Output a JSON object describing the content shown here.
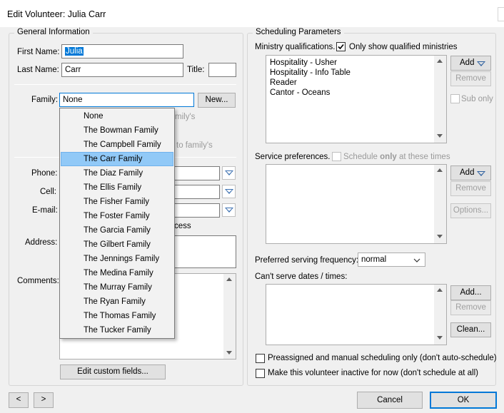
{
  "window": {
    "title": "Edit Volunteer: Julia Carr"
  },
  "general": {
    "legend": "General Information",
    "first_name_label": "First Name:",
    "first_name_value": "Julia",
    "last_name_label": "Last Name:",
    "last_name_value": "Carr",
    "title_label": "Title:",
    "title_value": "",
    "family_label": "Family:",
    "family_value": "None",
    "new_button": "New...",
    "hint_line1_suffix": "mily's",
    "hint_line2_suffix": "to family's",
    "phone_label": "Phone:",
    "cell_label": "Cell:",
    "email_label": "E-mail:",
    "access_suffix": "cess",
    "address_label": "Address:",
    "comments_label": "Comments:",
    "edit_custom_fields_button": "Edit custom fields..."
  },
  "family_dropdown": {
    "items": [
      "None",
      "The Bowman Family",
      "The Campbell Family",
      "The Carr Family",
      "The Diaz Family",
      "The Ellis Family",
      "The Fisher Family",
      "The Foster Family",
      "The Garcia Family",
      "The Gilbert Family",
      "The Jennings Family",
      "The Medina Family",
      "The Murray Family",
      "The Ryan Family",
      "The Thomas Family",
      "The Tucker Family"
    ],
    "selected": "The Carr Family"
  },
  "scheduling": {
    "legend": "Scheduling Parameters",
    "ministry_label": "Ministry qualifications.",
    "only_qualified_label": "Only show qualified ministries",
    "only_qualified_checked": true,
    "ministries": [
      "Hospitality - Usher",
      "Hospitality - Info Table",
      "Reader",
      "Cantor - Oceans"
    ],
    "add_button": "Add",
    "remove_button": "Remove",
    "sub_only_label": "Sub only",
    "service_pref_label": "Service preferences.",
    "schedule_only_prefix": "Schedule ",
    "schedule_only_bold": "only",
    "schedule_only_suffix": " at these times",
    "service_add_button": "Add",
    "service_remove_button": "Remove",
    "options_button": "Options...",
    "pref_freq_label": "Preferred serving frequency:",
    "pref_freq_value": "normal",
    "cant_serve_label": "Can't serve dates / times:",
    "cs_add_button": "Add...",
    "cs_remove_button": "Remove",
    "cs_clean_button": "Clean...",
    "preassigned_label": "Preassigned and manual scheduling only (don't auto-schedule)",
    "inactive_label": "Make this volunteer inactive for now (don't schedule at all)"
  },
  "footer": {
    "prev_button": "<",
    "next_button": ">",
    "cancel_button": "Cancel",
    "ok_button": "OK"
  }
}
